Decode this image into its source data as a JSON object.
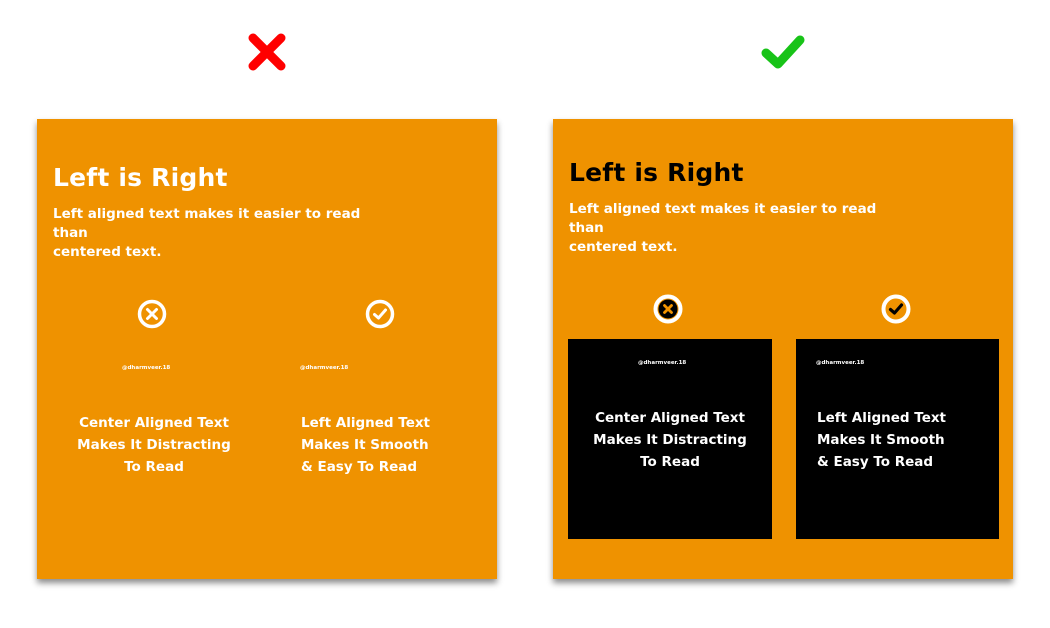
{
  "verdicts": {
    "bad": {
      "icon": "red-x-icon",
      "color": "#ff0000"
    },
    "good": {
      "icon": "green-check-icon",
      "color": "#18c318"
    }
  },
  "colors": {
    "card_bg": "#ef9200",
    "panel_bg": "#000000",
    "text_light": "#ffffff",
    "text_dark": "#000000"
  },
  "cards": {
    "bad": {
      "title": "Left is Right",
      "subtitle_line1": "Left aligned text makes it easier to read than",
      "subtitle_line2": "centered text.",
      "left_panel": {
        "icon": "x-circle-icon",
        "handle": "@dharmveer.18",
        "line1": "Center Aligned Text",
        "line2": "Makes It Distracting",
        "line3": "To Read"
      },
      "right_panel": {
        "icon": "check-circle-icon",
        "handle": "@dharmveer.18",
        "line1": "Left Aligned Text",
        "line2": "Makes It Smooth",
        "line3": "& Easy To Read"
      }
    },
    "good": {
      "title": "Left is Right",
      "subtitle_line1": "Left aligned text makes it easier to read than",
      "subtitle_line2": "centered text.",
      "left_panel": {
        "icon": "x-circle-icon",
        "handle": "@dharmveer.18",
        "line1": "Center Aligned Text",
        "line2": "Makes It Distracting",
        "line3": "To Read"
      },
      "right_panel": {
        "icon": "check-circle-icon",
        "handle": "@dharmveer.18",
        "line1": "Left Aligned Text",
        "line2": "Makes It Smooth",
        "line3": "& Easy To Read"
      }
    }
  }
}
